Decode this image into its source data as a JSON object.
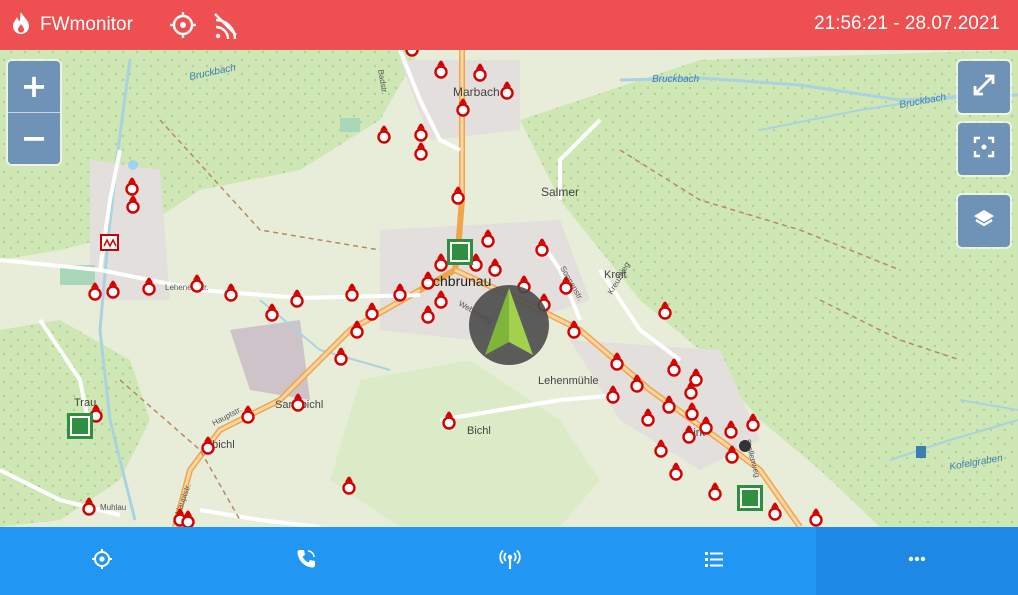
{
  "header": {
    "app_name": "FWmonitor",
    "datetime": "21:56:21 - 28.07.2021",
    "bg_color": "#ee4f51"
  },
  "map": {
    "labels": {
      "marbach": "Marbach",
      "salmer": "Salmer",
      "kreit": "Kreit",
      "town": "schbrunau",
      "lehenmuehle": "Lehenmühle",
      "bichl": "Bichl",
      "birk": "Birk",
      "bruckbach1": "Bruckbach",
      "bruckbach2": "Bruckbach",
      "bruckbach3": "Bruckbach",
      "traun": "Trau",
      "sandbichl": "Sandbichl",
      "kofelgraben": "Kofelgraben",
      "muehlau": "Muhlau",
      "hauptstr1": "Hauptstr.",
      "hauptstr2": "Hauptstr.",
      "lehenerstr": "Lehener Str.",
      "badstr": "Badstr.",
      "weberweg": "Weberweg",
      "sonnenstr": "Sonnenstr.",
      "kreuzweg": "Kreuzweg",
      "stollenweg": "Stollenweg"
    }
  },
  "controls": {
    "zoom_in_label": "+",
    "zoom_out_label": "−",
    "fullscreen_icon": "expand-icon",
    "center_icon": "focus-icon",
    "layers_icon": "layers-icon"
  },
  "bottom_nav": {
    "items": [
      {
        "icon": "map-target-icon"
      },
      {
        "icon": "phone-icon"
      },
      {
        "icon": "broadcast-icon"
      },
      {
        "icon": "list-icon"
      },
      {
        "icon": "more-icon"
      }
    ],
    "bg_color": "#2196f3"
  }
}
